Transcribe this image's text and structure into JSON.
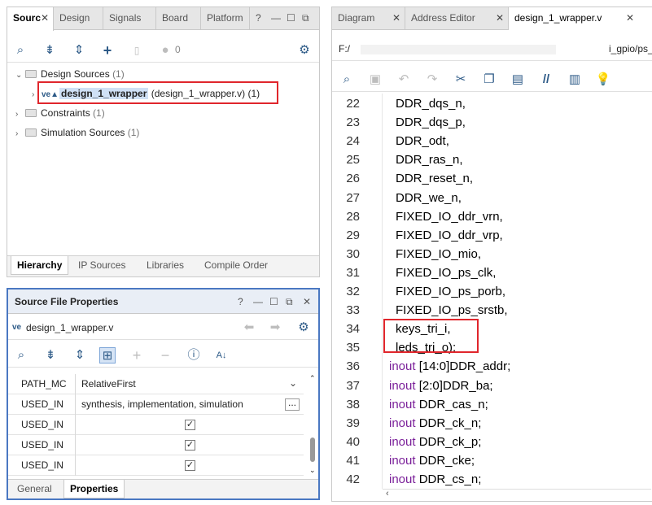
{
  "sources_panel": {
    "tabs": [
      "Sourc",
      "Design",
      "Signals",
      "Board",
      "Platform"
    ],
    "window_controls": [
      "?",
      "—",
      "☐",
      "⧉"
    ],
    "toolbar_badge": "0",
    "tree": {
      "design_sources": {
        "label": "Design Sources",
        "count": "(1)"
      },
      "wrapper_item": {
        "name": "design_1_wrapper",
        "detail": "(design_1_wrapper.v)",
        "count": "(1)"
      },
      "constraints": {
        "label": "Constraints",
        "count": "(1)"
      },
      "simulation_sources": {
        "label": "Simulation Sources",
        "count": "(1)"
      }
    },
    "bottom_tabs": [
      "Hierarchy",
      "IP Sources",
      "Libraries",
      "Compile Order"
    ]
  },
  "properties_panel": {
    "title": "Source File Properties",
    "window_controls": [
      "?",
      "—",
      "☐",
      "⧉",
      "✕"
    ],
    "file_name": "design_1_wrapper.v",
    "rows": [
      {
        "name": "PATH_MC",
        "value": "RelativeFirst"
      },
      {
        "name": "USED_IN",
        "value": "synthesis, implementation, simulation"
      },
      {
        "name": "USED_IN",
        "value": "✓"
      },
      {
        "name": "USED_IN",
        "value": "✓"
      },
      {
        "name": "USED_IN",
        "value": "✓"
      }
    ],
    "bottom_tabs": [
      "General",
      "Properties"
    ]
  },
  "editor": {
    "tabs": [
      "Diagram",
      "Address Editor",
      "design_1_wrapper.v"
    ],
    "path_start": "F:/",
    "path_end": "i_gpio/ps_",
    "lines": [
      {
        "n": "22",
        "kw": "",
        "text": "DDR_dqs_n,"
      },
      {
        "n": "23",
        "kw": "",
        "text": "DDR_dqs_p,"
      },
      {
        "n": "24",
        "kw": "",
        "text": "DDR_odt,"
      },
      {
        "n": "25",
        "kw": "",
        "text": "DDR_ras_n,"
      },
      {
        "n": "26",
        "kw": "",
        "text": "DDR_reset_n,"
      },
      {
        "n": "27",
        "kw": "",
        "text": "DDR_we_n,"
      },
      {
        "n": "28",
        "kw": "",
        "text": "FIXED_IO_ddr_vrn,"
      },
      {
        "n": "29",
        "kw": "",
        "text": "FIXED_IO_ddr_vrp,"
      },
      {
        "n": "30",
        "kw": "",
        "text": "FIXED_IO_mio,"
      },
      {
        "n": "31",
        "kw": "",
        "text": "FIXED_IO_ps_clk,"
      },
      {
        "n": "32",
        "kw": "",
        "text": "FIXED_IO_ps_porb,"
      },
      {
        "n": "33",
        "kw": "",
        "text": "FIXED_IO_ps_srstb,"
      },
      {
        "n": "34",
        "kw": "",
        "text": "keys_tri_i,"
      },
      {
        "n": "35",
        "kw": "",
        "text": "leds_tri_o);"
      },
      {
        "n": "36",
        "kw": "inout",
        "text": "[14:0]DDR_addr;"
      },
      {
        "n": "37",
        "kw": "inout",
        "text": "[2:0]DDR_ba;"
      },
      {
        "n": "38",
        "kw": "inout",
        "text": "DDR_cas_n;"
      },
      {
        "n": "39",
        "kw": "inout",
        "text": "DDR_ck_n;"
      },
      {
        "n": "40",
        "kw": "inout",
        "text": "DDR_ck_p;"
      },
      {
        "n": "41",
        "kw": "inout",
        "text": "DDR_cke;"
      },
      {
        "n": "42",
        "kw": "inout",
        "text": "DDR_cs_n;"
      }
    ]
  },
  "colors": {
    "accent": "#2d5a87",
    "highlight_box": "#e0262c",
    "keyword": "#7a1f99",
    "selected_row": "#cfe0f5"
  }
}
